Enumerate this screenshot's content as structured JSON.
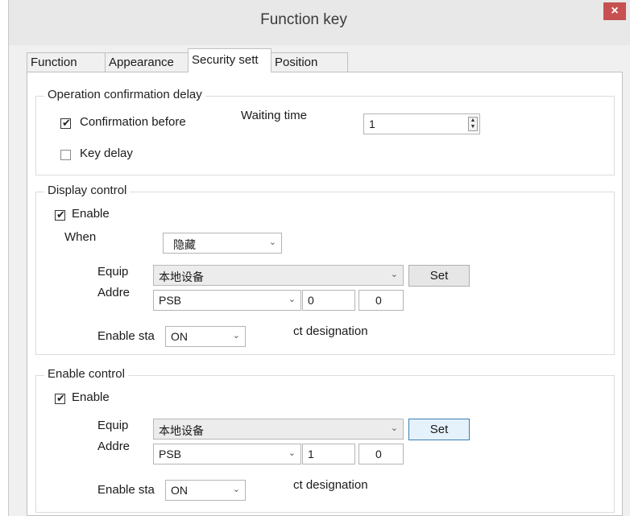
{
  "window": {
    "title": "Function key",
    "close_glyph": "×"
  },
  "tabs": [
    {
      "label": "Function"
    },
    {
      "label": "Appearance"
    },
    {
      "label": "Security sett"
    },
    {
      "label": "Position"
    }
  ],
  "operation_delay": {
    "group_label": "Operation confirmation delay",
    "confirm_before": {
      "label": "Confirmation before",
      "checked": true
    },
    "waiting_time_label": "Waiting time",
    "waiting_time_value": "1",
    "key_delay": {
      "label": "Key delay",
      "checked": false
    }
  },
  "display_control": {
    "group_label": "Display control",
    "enable": {
      "label": "Enable",
      "checked": true
    },
    "when_label": "When",
    "when_value": "隐藏",
    "equip_label": "Equip",
    "equip_value": "本地设备",
    "set_label": "Set",
    "addr_label": "Addre",
    "addr_type": "PSB",
    "addr_num1": "0",
    "addr_num2": "0",
    "enable_state_label": "Enable sta",
    "enable_state_value": "ON",
    "bit_designation_label": "ct designation"
  },
  "enable_control": {
    "group_label": "Enable control",
    "enable": {
      "label": "Enable",
      "checked": true
    },
    "equip_label": "Equip",
    "equip_value": "本地设备",
    "set_label": "Set",
    "addr_label": "Addre",
    "addr_type": "PSB",
    "addr_num1": "1",
    "addr_num2": "0",
    "enable_state_label": "Enable sta",
    "enable_state_value": "ON",
    "bit_designation_label": "ct designation"
  },
  "glyphs": {
    "check": "✔",
    "dropdown": "⌄",
    "spin_up": "▲",
    "spin_down": "▼"
  },
  "colors": {
    "close_button": "#c75050",
    "focus_border": "#3c7fb1"
  }
}
